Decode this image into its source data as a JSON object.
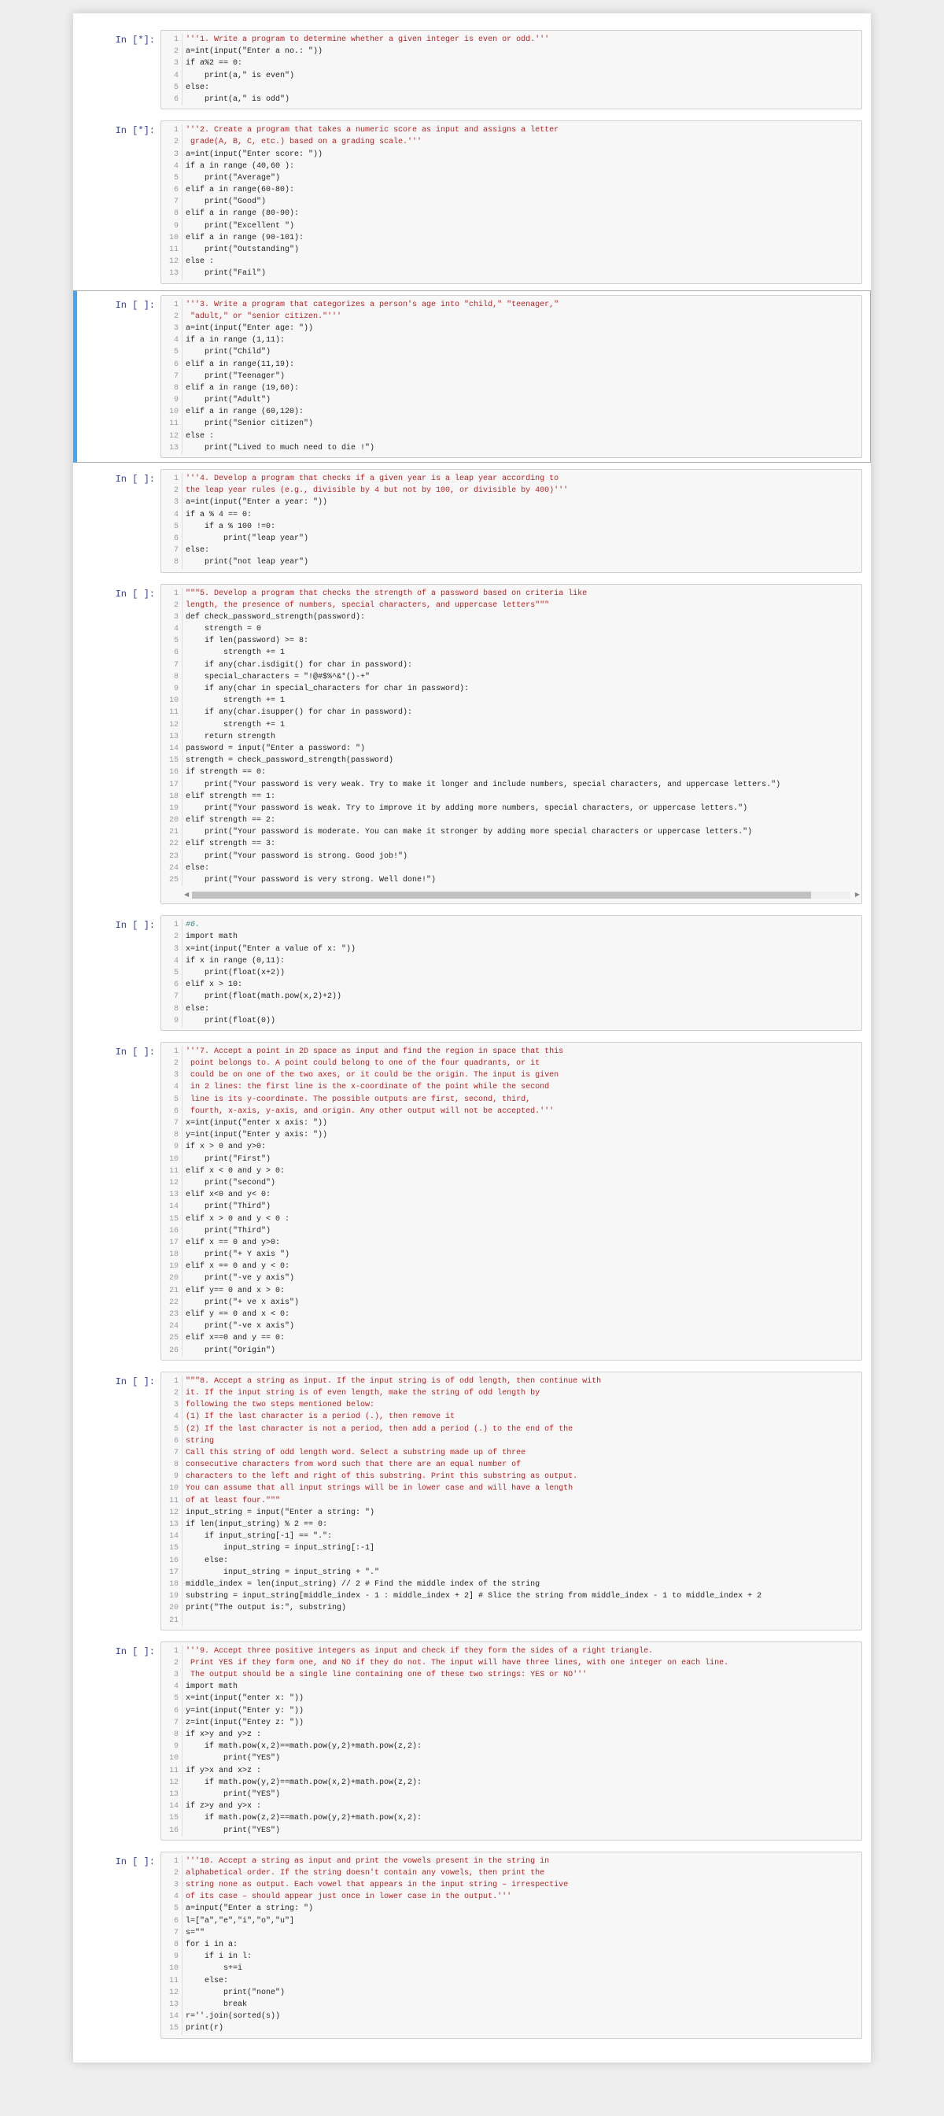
{
  "notebook": {
    "cells": [
      {
        "prompt": "In [*]:",
        "selected": false,
        "lines": [
          "'''1. Write a program to determine whether a given integer is even or odd.'''",
          "a=int(input(\"Enter a no.: \"))",
          "if a%2 == 0:",
          "    print(a,\" is even\")",
          "else:",
          "    print(a,\" is odd\")"
        ]
      },
      {
        "prompt": "In [*]:",
        "selected": false,
        "lines": [
          "'''2. Create a program that takes a numeric score as input and assigns a letter",
          " grade(A, B, C, etc.) based on a grading scale.'''",
          "a=int(input(\"Enter score: \"))",
          "if a in range (40,60 ):",
          "    print(\"Average\")",
          "elif a in range(60-80):",
          "    print(\"Good\")",
          "elif a in range (80-90):",
          "    print(\"Excellent \")",
          "elif a in range (90-101):",
          "    print(\"Outstanding\")",
          "else :",
          "    print(\"Fail\")"
        ]
      },
      {
        "prompt": "In [ ]:",
        "selected": true,
        "lines": [
          "'''3. Write a program that categorizes a person's age into \"child,\" \"teenager,\"",
          " \"adult,\" or \"senior citizen.\"'''",
          "a=int(input(\"Enter age: \"))",
          "if a in range (1,11):",
          "    print(\"Child\")",
          "elif a in range(11,19):",
          "    print(\"Teenager\")",
          "elif a in range (19,60):",
          "    print(\"Adult\")",
          "elif a in range (60,120):",
          "    print(\"Senior citizen\")",
          "else :",
          "    print(\"Lived to much need to die !\")"
        ]
      },
      {
        "prompt": "In [ ]:",
        "selected": false,
        "lines": [
          "'''4. Develop a program that checks if a given year is a leap year according to",
          "the leap year rules (e.g., divisible by 4 but not by 100, or divisible by 400)'''",
          "a=int(input(\"Enter a year: \"))",
          "if a % 4 == 0:",
          "    if a % 100 !=0:",
          "        print(\"leap year\")",
          "else:",
          "    print(\"not leap year\")"
        ]
      },
      {
        "prompt": "In [ ]:",
        "selected": false,
        "scrollbar": true,
        "lines": [
          "\"\"\"5. Develop a program that checks the strength of a password based on criteria like",
          "length, the presence of numbers, special characters, and uppercase letters\"\"\"",
          "def check_password_strength(password):",
          "    strength = 0",
          "    if len(password) >= 8:",
          "        strength += 1",
          "    if any(char.isdigit() for char in password):",
          "    special_characters = \"!@#$%^&*()-+\"",
          "    if any(char in special_characters for char in password):",
          "        strength += 1",
          "    if any(char.isupper() for char in password):",
          "        strength += 1",
          "    return strength",
          "password = input(\"Enter a password: \")",
          "strength = check_password_strength(password)",
          "if strength == 0:",
          "    print(\"Your password is very weak. Try to make it longer and include numbers, special characters, and uppercase letters.\")",
          "elif strength == 1:",
          "    print(\"Your password is weak. Try to improve it by adding more numbers, special characters, or uppercase letters.\")",
          "elif strength == 2:",
          "    print(\"Your password is moderate. You can make it stronger by adding more special characters or uppercase letters.\")",
          "elif strength == 3:",
          "    print(\"Your password is strong. Good job!\")",
          "else:",
          "    print(\"Your password is very strong. Well done!\")"
        ]
      },
      {
        "prompt": "In [ ]:",
        "selected": false,
        "lines": [
          "#6.",
          "import math",
          "x=int(input(\"Enter a value of x: \"))",
          "if x in range (0,11):",
          "    print(float(x+2))",
          "elif x > 10:",
          "    print(float(math.pow(x,2)+2))",
          "else:",
          "    print(float(0))"
        ]
      },
      {
        "prompt": "In [ ]:",
        "selected": false,
        "lines": [
          "'''7. Accept a point in 2D space as input and find the region in space that this",
          " point belongs to. A point could belong to one of the four quadrants, or it",
          " could be on one of the two axes, or it could be the origin. The input is given",
          " in 2 lines: the first line is the x-coordinate of the point while the second",
          " line is its y-coordinate. The possible outputs are first, second, third,",
          " fourth, x-axis, y-axis, and origin. Any other output will not be accepted.'''",
          "x=int(input(\"enter x axis: \"))",
          "y=int(input(\"Enter y axis: \"))",
          "if x > 0 and y>0:",
          "    print(\"First\")",
          "elif x < 0 and y > 0:",
          "    print(\"second\")",
          "elif x<0 and y< 0:",
          "    print(\"Third\")",
          "elif x > 0 and y < 0 :",
          "    print(\"Third\")",
          "elif x == 0 and y>0:",
          "    print(\"+ Y axis \")",
          "elif x == 0 and y < 0:",
          "    print(\"-ve y axis\")",
          "elif y== 0 and x > 0:",
          "    print(\"+ ve x axis\")",
          "elif y == 0 and x < 0:",
          "    print(\"-ve x axis\")",
          "elif x==0 and y == 0:",
          "    print(\"Origin\")"
        ]
      },
      {
        "prompt": "In [ ]:",
        "selected": false,
        "lines": [
          "\"\"\"8. Accept a string as input. If the input string is of odd length, then continue with",
          "it. If the input string is of even length, make the string of odd length by",
          "following the two steps mentioned below:",
          "(1) If the last character is a period (.), then remove it",
          "(2) If the last character is not a period, then add a period (.) to the end of the",
          "string",
          "Call this string of odd length word. Select a substring made up of three",
          "consecutive characters from word such that there are an equal number of",
          "characters to the left and right of this substring. Print this substring as output.",
          "You can assume that all input strings will be in lower case and will have a length",
          "of at least four.\"\"\"",
          "input_string = input(\"Enter a string: \")",
          "if len(input_string) % 2 == 0:",
          "    if input_string[-1] == \".\":",
          "        input_string = input_string[:-1]",
          "    else:",
          "        input_string = input_string + \".\"",
          "middle_index = len(input_string) // 2 # Find the middle index of the string",
          "substring = input_string[middle_index - 1 : middle_index + 2] # Slice the string from middle_index - 1 to middle_index + 2",
          "print(\"The output is:\", substring)",
          ""
        ]
      },
      {
        "prompt": "In [ ]:",
        "selected": false,
        "lines": [
          "'''9. Accept three positive integers as input and check if they form the sides of a right triangle.",
          " Print YES if they form one, and NO if they do not. The input will have three lines, with one integer on each line.",
          " The output should be a single line containing one of these two strings: YES or NO'''",
          "import math",
          "x=int(input(\"enter x: \"))",
          "y=int(input(\"Enter y: \"))",
          "z=int(input(\"Entey z: \"))",
          "if x>y and y>z :",
          "    if math.pow(x,2)==math.pow(y,2)+math.pow(z,2):",
          "        print(\"YES\")",
          "if y>x and x>z :",
          "    if math.pow(y,2)==math.pow(x,2)+math.pow(z,2):",
          "        print(\"YES\")",
          "if z>y and y>x :",
          "    if math.pow(z,2)==math.pow(y,2)+math.pow(x,2):",
          "        print(\"YES\")"
        ]
      },
      {
        "prompt": "In [ ]:",
        "selected": false,
        "lines": [
          "'''10. Accept a string as input and print the vowels present in the string in",
          "alphabetical order. If the string doesn't contain any vowels, then print the",
          "string none as output. Each vowel that appears in the input string – irrespective",
          "of its case – should appear just once in lower case in the output.'''",
          "a=input(\"Enter a string: \")",
          "l=[\"a\",\"e\",\"i\",\"o\",\"u\"]",
          "s=\"\"",
          "for i in a:",
          "    if i in l:",
          "        s+=i",
          "    else:",
          "        print(\"none\")",
          "        break",
          "r=''.join(sorted(s))",
          "print(r)"
        ]
      }
    ]
  },
  "colors": {
    "selected_cell_bar": "#42A5F5",
    "prompt": "#303F9F"
  }
}
